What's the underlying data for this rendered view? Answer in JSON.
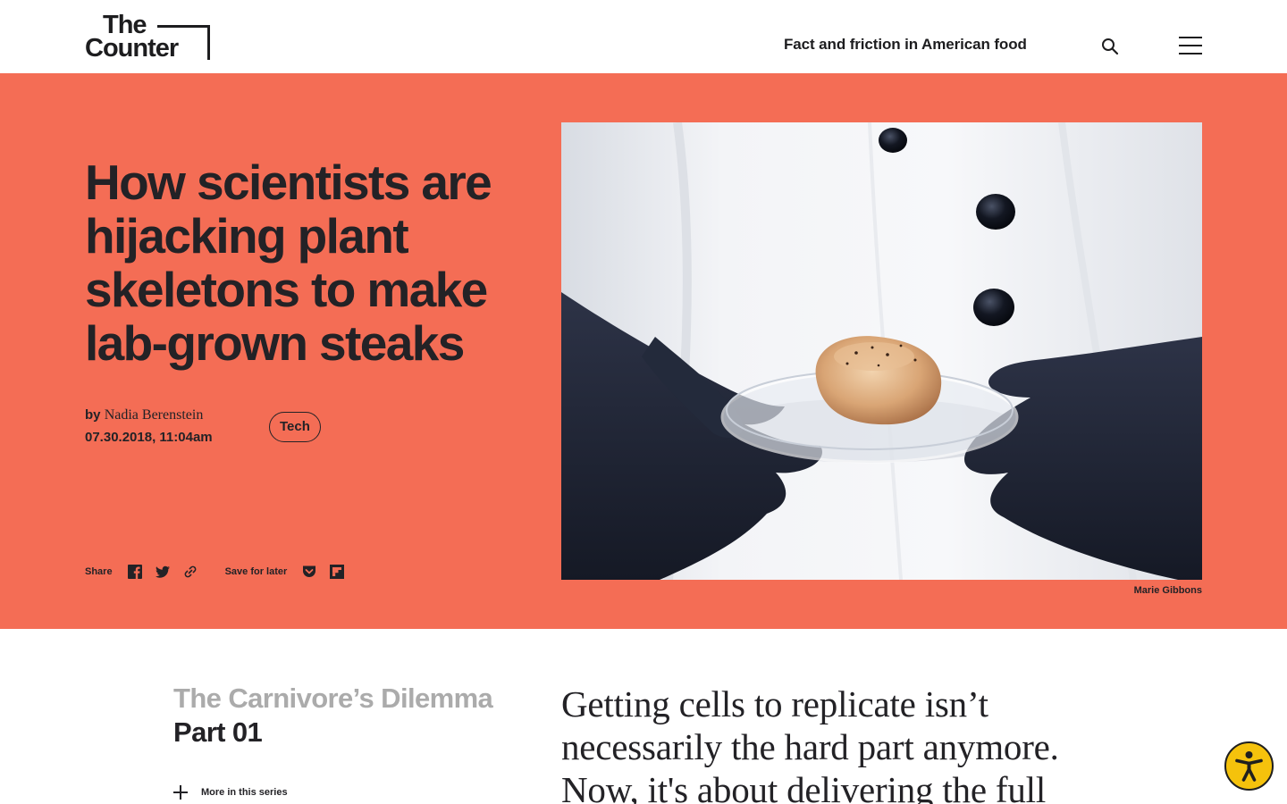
{
  "header": {
    "logo_line1": "The",
    "logo_line2": "Counter",
    "tagline": "Fact and friction in American food"
  },
  "article": {
    "headline": "How scientists are hijacking plant skeletons to make lab-grown steaks",
    "byline_prefix": "by",
    "author": "Nadia Berenstein",
    "date": "07.30.2018, 11:04am",
    "tag": "Tech",
    "share_label": "Share",
    "save_label": "Save for later",
    "photo_credit": "Marie Gibbons",
    "series_title": "The Carnivore’s Dilemma",
    "series_part": "Part 01",
    "more_in_series": "More in this series",
    "dek": "Getting cells to replicate isn’t necessarily the hard part anymore. Now, it's about delivering the full"
  },
  "icons": [
    "search-icon",
    "menu-icon",
    "facebook-icon",
    "twitter-icon",
    "link-icon",
    "pocket-icon",
    "flipboard-icon",
    "plus-icon",
    "accessibility-icon"
  ],
  "colors": {
    "hero_background": "#f46d55",
    "text": "#232226",
    "series_title": "#ababab",
    "accessibility_button": "#f5c20c"
  }
}
